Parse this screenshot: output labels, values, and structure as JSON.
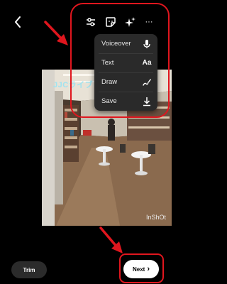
{
  "icons": {
    "back": "chevron-left-icon",
    "adjust": "sliders-icon",
    "sticker": "sticker-icon",
    "effects": "sparkles-icon",
    "more": "ellipsis-icon"
  },
  "more_label": "···",
  "menu": {
    "items": [
      {
        "label": "Voiceover",
        "icon": "microphone-icon"
      },
      {
        "label": "Text",
        "icon_text": "Aa",
        "icon": "text-icon"
      },
      {
        "label": "Draw",
        "icon": "draw-icon"
      },
      {
        "label": "Save",
        "icon": "download-icon"
      }
    ]
  },
  "video": {
    "caption": "JJCライブ",
    "watermark": "InShOt"
  },
  "bottom": {
    "trim_label": "Trim",
    "next_label": "Next",
    "next_chevron": "›"
  },
  "colors": {
    "annotation": "#e0161e",
    "background": "#000000",
    "menu_bg": "#2a2a2a"
  }
}
